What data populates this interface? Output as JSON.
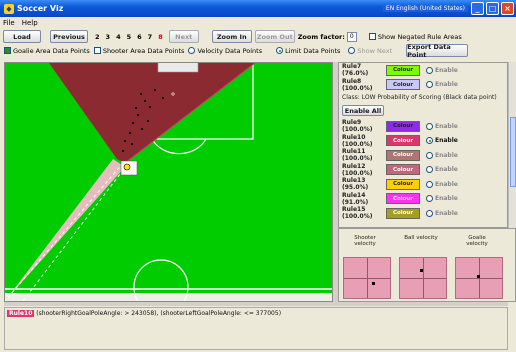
{
  "window": {
    "title": "Soccer Viz",
    "language": "EN English (United States)"
  },
  "menu": [
    "File",
    "Help"
  ],
  "toolbar": {
    "load": "Load",
    "previous": "Previous",
    "pages": [
      "2",
      "3",
      "4",
      "5",
      "6",
      "7",
      "8"
    ],
    "current_page": "8",
    "next": "Next",
    "zoom_in": "Zoom In",
    "zoom_out": "Zoom Out",
    "zoom_factor_label": "Zoom factor:",
    "zoom_factor_value": "0",
    "show_negated": "Show Negated Rule Areas"
  },
  "options": {
    "goalie": "Goalie Area Data Points",
    "shooter": "Shooter Area Data Points",
    "velocity": "Velocity Data Points",
    "limit": "Limit Data Points",
    "show_next": "Show Next",
    "export": "Export Data Point"
  },
  "rules_top": [
    {
      "label": "Rule7",
      "pct": "(76.0%)",
      "colour_text": "Colour",
      "color": "#7cfc00",
      "enabled": false
    },
    {
      "label": "Rule8",
      "pct": "(100.0%)",
      "colour_text": "Colour",
      "color": "#c8c8f8",
      "enabled": false
    }
  ],
  "class_label": "Class: LOW Probability of Scoring (Black data point)",
  "enable_all": "Enable All",
  "rules": [
    {
      "label": "Rule9",
      "pct": "(100.0%)",
      "colour_text": "Colour",
      "color": "#8e2be8",
      "enabled": false
    },
    {
      "label": "Rule10",
      "pct": "(100.0%)",
      "colour_text": "Colour",
      "color": "#d9386f",
      "enabled": true
    },
    {
      "label": "Rule11",
      "pct": "(100.0%)",
      "colour_text": "Colour",
      "color": "#b07474",
      "enabled": false
    },
    {
      "label": "Rule12",
      "pct": "(100.0%)",
      "colour_text": "Colour",
      "color": "#c6637d",
      "enabled": false
    },
    {
      "label": "Rule13",
      "pct": "(95.0%)",
      "colour_text": "Colour",
      "color": "#ffd000",
      "enabled": false
    },
    {
      "label": "Rule14",
      "pct": "(91.0%)",
      "colour_text": "Colour",
      "color": "#ff30f0",
      "enabled": false
    },
    {
      "label": "Rule15",
      "pct": "(100.0%)",
      "colour_text": "Colour",
      "color": "#a4a01c",
      "enabled": false
    }
  ],
  "enable_label": "Enable",
  "velocity": {
    "shooter": "Shooter velocity",
    "ball": "Ball velocity",
    "goalie": "Goalie velocity"
  },
  "status": {
    "rule": "Rule10",
    "text": "(shooterRightGoalPoleAngle: > 243058), (shooterLeftGoalPoleAngle: <= 377005)"
  },
  "colors": {
    "field": "#00cc00",
    "dark_region": "#8b2a30",
    "light_region": "#f2bcc9",
    "accent": "#0a5ad8"
  }
}
